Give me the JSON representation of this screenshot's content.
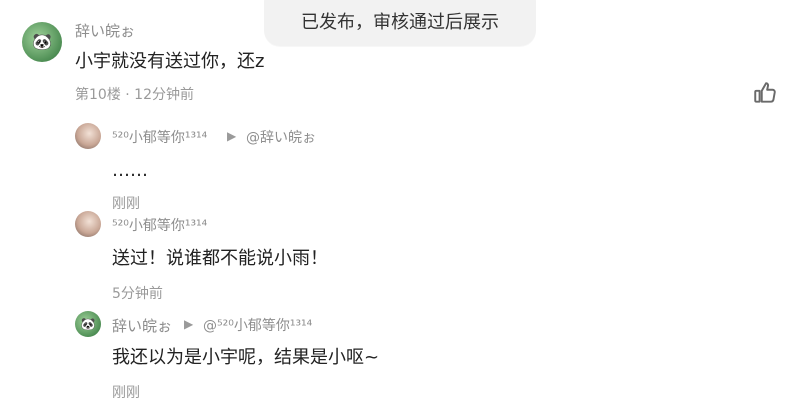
{
  "toast": {
    "text": "已发布，审核通过后展示"
  },
  "main_comment": {
    "username": "辞い皖ぉ",
    "text": "小宇就没有送过你，还z",
    "meta": "第10楼 · 12分钟前"
  },
  "replies": [
    {
      "username": "⁵²⁰小郁等你¹³¹⁴",
      "reply_to": "@辞い皖ぉ",
      "text": "……",
      "time": "刚刚"
    },
    {
      "username": "⁵²⁰小郁等你¹³¹⁴",
      "text": "送过！说谁都不能说小雨！",
      "time": "5分钟前"
    },
    {
      "username": "辞い皖ぉ",
      "reply_to": "@⁵²⁰小郁等你¹³¹⁴",
      "text": "我还以为是小宇呢，结果是小呕~",
      "time": "刚刚"
    }
  ],
  "icons": {
    "like": "thumbs-up-icon",
    "reply_arrow": "play-arrow-icon",
    "avatar_panda": "panda-avatar"
  }
}
